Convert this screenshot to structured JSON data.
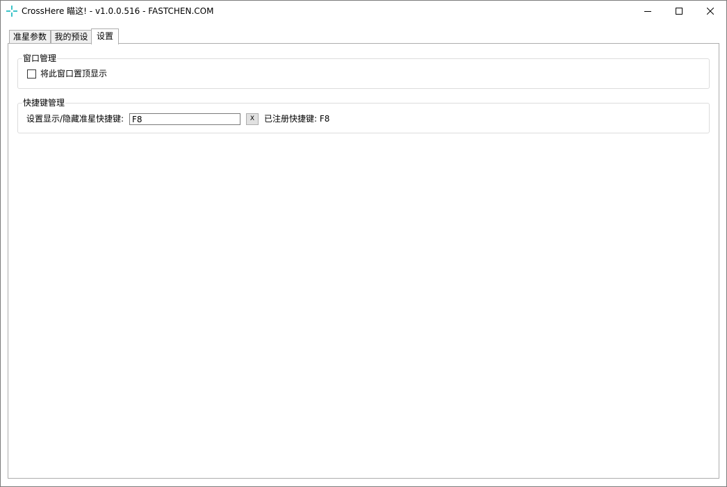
{
  "window": {
    "title": "CrossHere 瞄这! - v1.0.0.516 - FASTCHEN.COM",
    "icon": "crosshair-icon",
    "accent_color": "#3cc3c8"
  },
  "tabs": [
    {
      "label": "准星参数",
      "selected": false
    },
    {
      "label": "我的预设",
      "selected": false
    },
    {
      "label": "设置",
      "selected": true
    }
  ],
  "settings": {
    "window_group": {
      "legend": "窗口管理",
      "topmost_checkbox": {
        "label": "将此窗口置顶显示",
        "checked": false
      }
    },
    "hotkey_group": {
      "legend": "快捷键管理",
      "hotkey_label": "设置显示/隐藏准星快捷键:",
      "hotkey_value": "F8",
      "clear_label": "X",
      "registered_text": "已注册快捷键: F8"
    }
  }
}
